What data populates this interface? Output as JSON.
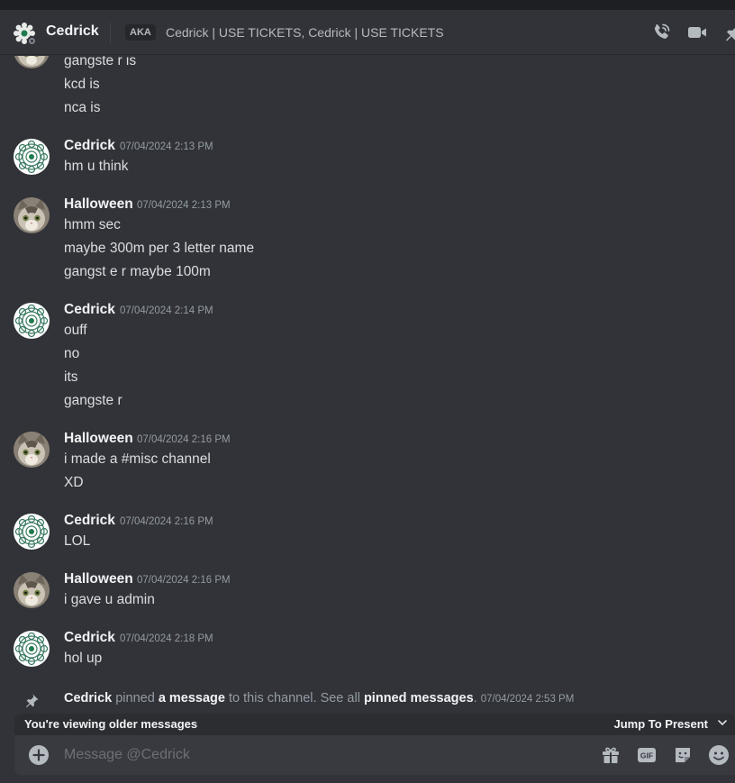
{
  "header": {
    "name": "Cedrick",
    "aka_badge": "AKA",
    "aka_names": "Cedrick | USE TICKETS, Cedrick | USE TICKETS",
    "icons": [
      "phone-call-icon",
      "video-call-icon",
      "pin-icon"
    ]
  },
  "messages": {
    "top_lines": [
      "gangste r is",
      "kcd is",
      "nca is"
    ],
    "groups": [
      {
        "author": "Cedrick",
        "timestamp": "07/04/2024 2:13 PM",
        "lines": [
          "hm u think"
        ]
      },
      {
        "author": "Halloween",
        "timestamp": "07/04/2024 2:13 PM",
        "lines": [
          "hmm sec",
          "maybe 300m per 3 letter name",
          "gangst e r maybe 100m"
        ]
      },
      {
        "author": "Cedrick",
        "timestamp": "07/04/2024 2:14 PM",
        "lines": [
          "ouff",
          "no",
          "its",
          "gangste r"
        ]
      },
      {
        "author": "Halloween",
        "timestamp": "07/04/2024 2:16 PM",
        "lines": [
          "i made a #misc channel",
          "XD"
        ]
      },
      {
        "author": "Cedrick",
        "timestamp": "07/04/2024 2:16 PM",
        "lines": [
          "LOL"
        ]
      },
      {
        "author": "Halloween",
        "timestamp": "07/04/2024 2:16 PM",
        "lines": [
          "i gave u admin"
        ]
      },
      {
        "author": "Cedrick",
        "timestamp": "07/04/2024 2:18 PM",
        "lines": [
          "hol up"
        ]
      }
    ],
    "pin_notice": {
      "author": "Cedrick",
      "text1": " pinned ",
      "link1": "a message",
      "text2": " to this channel. See all ",
      "link2": "pinned messages",
      "text3": ". ",
      "timestamp": "07/04/2024 2:53 PM"
    }
  },
  "older_bar": {
    "notice": "You're viewing older messages",
    "jump": "Jump To Present"
  },
  "composer": {
    "placeholder": "Message @Cedrick",
    "icons": [
      "gift-icon",
      "gif-icon",
      "sticker-icon",
      "emoji-icon"
    ]
  },
  "colors": {
    "background": "#313338",
    "composer": "#383a40",
    "author": "#f2f3f5",
    "muted": "#949ba4"
  }
}
